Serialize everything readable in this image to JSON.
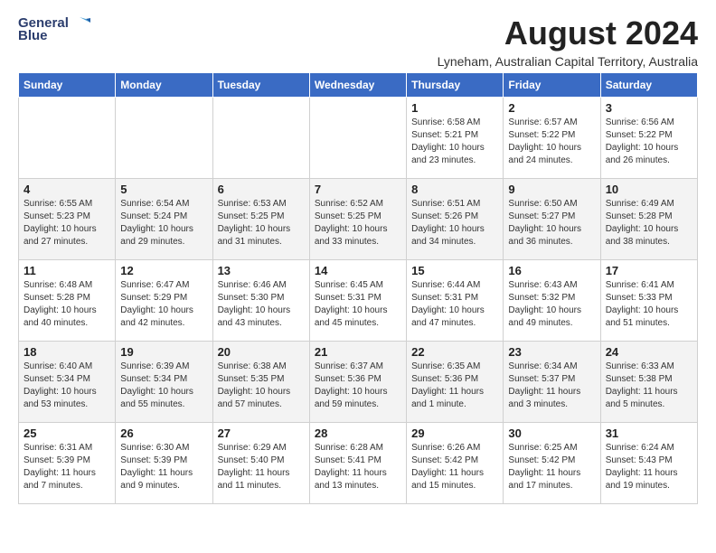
{
  "logo": {
    "line1": "General",
    "line2": "Blue"
  },
  "title": "August 2024",
  "subtitle": "Lyneham, Australian Capital Territory, Australia",
  "days_of_week": [
    "Sunday",
    "Monday",
    "Tuesday",
    "Wednesday",
    "Thursday",
    "Friday",
    "Saturday"
  ],
  "weeks": [
    [
      {
        "day": "",
        "info": ""
      },
      {
        "day": "",
        "info": ""
      },
      {
        "day": "",
        "info": ""
      },
      {
        "day": "",
        "info": ""
      },
      {
        "day": "1",
        "info": "Sunrise: 6:58 AM\nSunset: 5:21 PM\nDaylight: 10 hours\nand 23 minutes."
      },
      {
        "day": "2",
        "info": "Sunrise: 6:57 AM\nSunset: 5:22 PM\nDaylight: 10 hours\nand 24 minutes."
      },
      {
        "day": "3",
        "info": "Sunrise: 6:56 AM\nSunset: 5:22 PM\nDaylight: 10 hours\nand 26 minutes."
      }
    ],
    [
      {
        "day": "4",
        "info": "Sunrise: 6:55 AM\nSunset: 5:23 PM\nDaylight: 10 hours\nand 27 minutes."
      },
      {
        "day": "5",
        "info": "Sunrise: 6:54 AM\nSunset: 5:24 PM\nDaylight: 10 hours\nand 29 minutes."
      },
      {
        "day": "6",
        "info": "Sunrise: 6:53 AM\nSunset: 5:25 PM\nDaylight: 10 hours\nand 31 minutes."
      },
      {
        "day": "7",
        "info": "Sunrise: 6:52 AM\nSunset: 5:25 PM\nDaylight: 10 hours\nand 33 minutes."
      },
      {
        "day": "8",
        "info": "Sunrise: 6:51 AM\nSunset: 5:26 PM\nDaylight: 10 hours\nand 34 minutes."
      },
      {
        "day": "9",
        "info": "Sunrise: 6:50 AM\nSunset: 5:27 PM\nDaylight: 10 hours\nand 36 minutes."
      },
      {
        "day": "10",
        "info": "Sunrise: 6:49 AM\nSunset: 5:28 PM\nDaylight: 10 hours\nand 38 minutes."
      }
    ],
    [
      {
        "day": "11",
        "info": "Sunrise: 6:48 AM\nSunset: 5:28 PM\nDaylight: 10 hours\nand 40 minutes."
      },
      {
        "day": "12",
        "info": "Sunrise: 6:47 AM\nSunset: 5:29 PM\nDaylight: 10 hours\nand 42 minutes."
      },
      {
        "day": "13",
        "info": "Sunrise: 6:46 AM\nSunset: 5:30 PM\nDaylight: 10 hours\nand 43 minutes."
      },
      {
        "day": "14",
        "info": "Sunrise: 6:45 AM\nSunset: 5:31 PM\nDaylight: 10 hours\nand 45 minutes."
      },
      {
        "day": "15",
        "info": "Sunrise: 6:44 AM\nSunset: 5:31 PM\nDaylight: 10 hours\nand 47 minutes."
      },
      {
        "day": "16",
        "info": "Sunrise: 6:43 AM\nSunset: 5:32 PM\nDaylight: 10 hours\nand 49 minutes."
      },
      {
        "day": "17",
        "info": "Sunrise: 6:41 AM\nSunset: 5:33 PM\nDaylight: 10 hours\nand 51 minutes."
      }
    ],
    [
      {
        "day": "18",
        "info": "Sunrise: 6:40 AM\nSunset: 5:34 PM\nDaylight: 10 hours\nand 53 minutes."
      },
      {
        "day": "19",
        "info": "Sunrise: 6:39 AM\nSunset: 5:34 PM\nDaylight: 10 hours\nand 55 minutes."
      },
      {
        "day": "20",
        "info": "Sunrise: 6:38 AM\nSunset: 5:35 PM\nDaylight: 10 hours\nand 57 minutes."
      },
      {
        "day": "21",
        "info": "Sunrise: 6:37 AM\nSunset: 5:36 PM\nDaylight: 10 hours\nand 59 minutes."
      },
      {
        "day": "22",
        "info": "Sunrise: 6:35 AM\nSunset: 5:36 PM\nDaylight: 11 hours\nand 1 minute."
      },
      {
        "day": "23",
        "info": "Sunrise: 6:34 AM\nSunset: 5:37 PM\nDaylight: 11 hours\nand 3 minutes."
      },
      {
        "day": "24",
        "info": "Sunrise: 6:33 AM\nSunset: 5:38 PM\nDaylight: 11 hours\nand 5 minutes."
      }
    ],
    [
      {
        "day": "25",
        "info": "Sunrise: 6:31 AM\nSunset: 5:39 PM\nDaylight: 11 hours\nand 7 minutes."
      },
      {
        "day": "26",
        "info": "Sunrise: 6:30 AM\nSunset: 5:39 PM\nDaylight: 11 hours\nand 9 minutes."
      },
      {
        "day": "27",
        "info": "Sunrise: 6:29 AM\nSunset: 5:40 PM\nDaylight: 11 hours\nand 11 minutes."
      },
      {
        "day": "28",
        "info": "Sunrise: 6:28 AM\nSunset: 5:41 PM\nDaylight: 11 hours\nand 13 minutes."
      },
      {
        "day": "29",
        "info": "Sunrise: 6:26 AM\nSunset: 5:42 PM\nDaylight: 11 hours\nand 15 minutes."
      },
      {
        "day": "30",
        "info": "Sunrise: 6:25 AM\nSunset: 5:42 PM\nDaylight: 11 hours\nand 17 minutes."
      },
      {
        "day": "31",
        "info": "Sunrise: 6:24 AM\nSunset: 5:43 PM\nDaylight: 11 hours\nand 19 minutes."
      }
    ]
  ]
}
